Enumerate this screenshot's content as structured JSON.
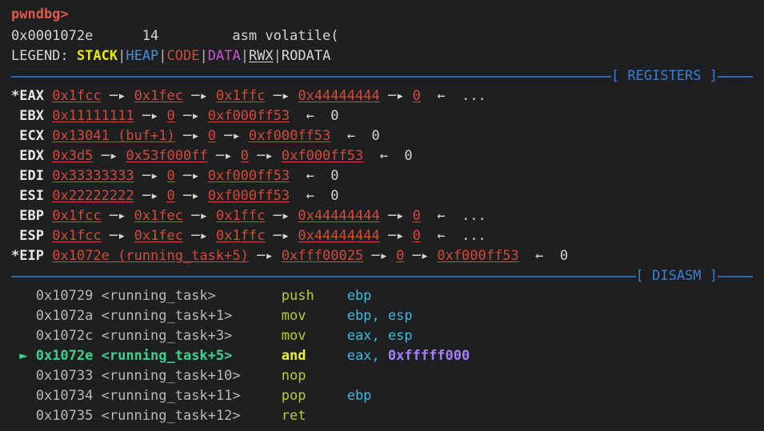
{
  "terminal": {
    "prompt": "pwndbg>",
    "source_line": {
      "address": "0x0001072e",
      "line_number": "14",
      "code": "asm volatile("
    },
    "legend": {
      "label": "LEGEND:",
      "items": [
        {
          "name": "STACK",
          "color": "#e8e800"
        },
        {
          "name": "HEAP",
          "color": "#4a90d9"
        },
        {
          "name": "CODE",
          "color": "#d64937"
        },
        {
          "name": "DATA",
          "color": "#cc56cc"
        },
        {
          "name": "RWX",
          "color": "#d6d6d6"
        },
        {
          "name": "RODATA",
          "color": "#d6d6d6"
        }
      ],
      "separator": "|"
    },
    "sections": {
      "registers_title": "[ REGISTERS ]",
      "disasm_title": "[ DISASM ]"
    },
    "arrow_deref": "─▸",
    "arrow_back": "←",
    "ellipsis": "...",
    "current_marker": "►"
  },
  "registers": [
    {
      "marker": "*",
      "name": "EAX",
      "chain": [
        "0x1fcc",
        "0x1fec",
        "0x1ffc",
        "0x44444444",
        "0"
      ],
      "tail": "←  ..."
    },
    {
      "marker": " ",
      "name": "EBX",
      "chain": [
        "0x11111111",
        "0",
        "0xf000ff53"
      ],
      "tail": "←  0"
    },
    {
      "marker": " ",
      "name": "ECX",
      "chain": [
        "0x13041 (buf+1)",
        "0",
        "0xf000ff53"
      ],
      "tail": "←  0"
    },
    {
      "marker": " ",
      "name": "EDX",
      "chain": [
        "0x3d5",
        "0x53f000ff",
        "0",
        "0xf000ff53"
      ],
      "tail": "←  0"
    },
    {
      "marker": " ",
      "name": "EDI",
      "chain": [
        "0x33333333",
        "0",
        "0xf000ff53"
      ],
      "tail": "←  0"
    },
    {
      "marker": " ",
      "name": "ESI",
      "chain": [
        "0x22222222",
        "0",
        "0xf000ff53"
      ],
      "tail": "←  0"
    },
    {
      "marker": " ",
      "name": "EBP",
      "chain": [
        "0x1fcc",
        "0x1fec",
        "0x1ffc",
        "0x44444444",
        "0"
      ],
      "tail": "←  ..."
    },
    {
      "marker": " ",
      "name": "ESP",
      "chain": [
        "0x1fcc",
        "0x1fec",
        "0x1ffc",
        "0x44444444",
        "0"
      ],
      "tail": "←  ..."
    },
    {
      "marker": "*",
      "name": "EIP",
      "chain": [
        "0x1072e (running_task+5)",
        "0xfff00025",
        "0",
        "0xf000ff53"
      ],
      "tail": "←  0"
    }
  ],
  "disasm": [
    {
      "current": false,
      "address": "0x10729",
      "symbol": "<running_task>",
      "mnemonic": "push",
      "operands": [
        {
          "text": "ebp",
          "kind": "reg"
        }
      ]
    },
    {
      "current": false,
      "address": "0x1072a",
      "symbol": "<running_task+1>",
      "mnemonic": "mov",
      "operands": [
        {
          "text": "ebp, esp",
          "kind": "reg"
        }
      ]
    },
    {
      "current": false,
      "address": "0x1072c",
      "symbol": "<running_task+3>",
      "mnemonic": "mov",
      "operands": [
        {
          "text": "eax, esp",
          "kind": "reg"
        }
      ]
    },
    {
      "current": true,
      "address": "0x1072e",
      "symbol": "<running_task+5>",
      "mnemonic": "and",
      "operands": [
        {
          "text": "eax, ",
          "kind": "reg"
        },
        {
          "text": "0xfffff000",
          "kind": "imm"
        }
      ]
    },
    {
      "current": false,
      "address": "0x10733",
      "symbol": "<running_task+10>",
      "mnemonic": "nop",
      "operands": []
    },
    {
      "current": false,
      "address": "0x10734",
      "symbol": "<running_task+11>",
      "mnemonic": "pop",
      "operands": [
        {
          "text": "ebp",
          "kind": "reg"
        }
      ]
    },
    {
      "current": false,
      "address": "0x10735",
      "symbol": "<running_task+12>",
      "mnemonic": "ret",
      "operands": []
    }
  ]
}
